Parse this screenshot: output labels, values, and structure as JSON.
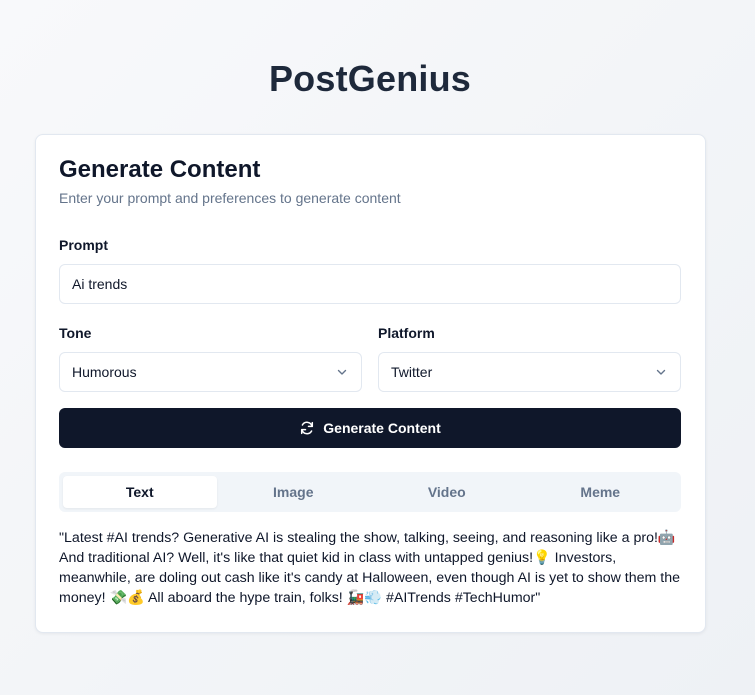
{
  "app": {
    "title": "PostGenius"
  },
  "card": {
    "title": "Generate Content",
    "subtitle": "Enter your prompt and preferences to generate content"
  },
  "form": {
    "prompt_label": "Prompt",
    "prompt_value": "Ai trends",
    "tone_label": "Tone",
    "tone_value": "Humorous",
    "platform_label": "Platform",
    "platform_value": "Twitter",
    "generate_label": "Generate Content"
  },
  "tabs": [
    {
      "label": "Text",
      "active": true
    },
    {
      "label": "Image",
      "active": false
    },
    {
      "label": "Video",
      "active": false
    },
    {
      "label": "Meme",
      "active": false
    }
  ],
  "output": {
    "text": "\"Latest #AI trends? Generative AI is stealing the show, talking, seeing, and reasoning like a pro!🤖 And traditional AI? Well, it's like that quiet kid in class with untapped genius!💡 Investors, meanwhile, are doling out cash like it's candy at Halloween, even though AI is yet to show them the money! 💸💰 All aboard the hype train, folks! 🚂💨 #AITrends #TechHumor\""
  },
  "icons": {
    "refresh": "refresh-icon",
    "chevron": "chevron-down-icon"
  },
  "colors": {
    "primary_button": "#0f172a",
    "muted_text": "#64748b",
    "border": "#e2e8f0"
  }
}
